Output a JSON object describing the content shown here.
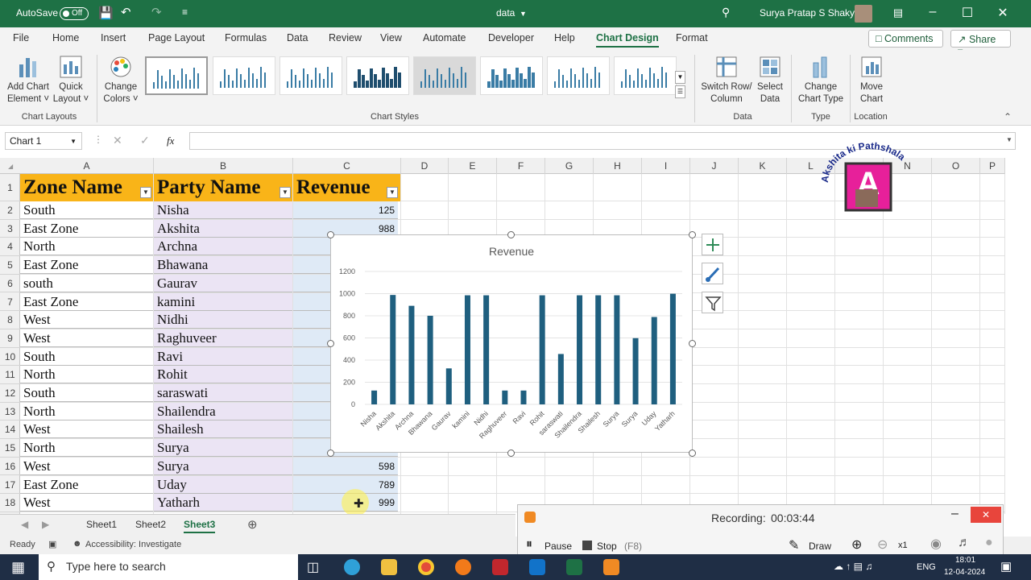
{
  "titlebar": {
    "autosave": "AutoSave",
    "toggle": "Off",
    "filename": "data",
    "user": "Surya Pratap S Shakya"
  },
  "tabs": [
    "File",
    "Home",
    "Insert",
    "Page Layout",
    "Formulas",
    "Data",
    "Review",
    "View",
    "Automate",
    "Developer",
    "Help",
    "Chart Design",
    "Format"
  ],
  "active_tab": "Chart Design",
  "top_buttons": {
    "comments": "Comments",
    "share": "Share"
  },
  "ribbon": {
    "add_chart_element": [
      "Add Chart",
      "Element"
    ],
    "quick_layout": [
      "Quick",
      "Layout"
    ],
    "change_colors": [
      "Change",
      "Colors"
    ],
    "switch_row_col": [
      "Switch Row/",
      "Column"
    ],
    "select_data": [
      "Select",
      "Data"
    ],
    "change_chart_type": [
      "Change",
      "Chart Type"
    ],
    "move_chart": [
      "Move",
      "Chart"
    ],
    "groups": {
      "chart_layouts": "Chart Layouts",
      "chart_styles": "Chart Styles",
      "data": "Data",
      "type": "Type",
      "location": "Location"
    }
  },
  "formula_bar": {
    "name_box": "Chart 1",
    "fx": "fx",
    "value": ""
  },
  "columns": [
    "A",
    "B",
    "C",
    "D",
    "E",
    "F",
    "G",
    "H",
    "I",
    "J",
    "K",
    "L",
    "M",
    "N",
    "O",
    "P"
  ],
  "rows": [
    "1",
    "2",
    "3",
    "4",
    "5",
    "6",
    "7",
    "8",
    "9",
    "10",
    "11",
    "12",
    "13",
    "14",
    "15",
    "16",
    "17",
    "18"
  ],
  "headers": {
    "zone": "Zone Name",
    "party": "Party Name",
    "revenue": "Revenue"
  },
  "table": [
    {
      "zone": "South",
      "party": "Nisha",
      "revenue": "125"
    },
    {
      "zone": "East Zone",
      "party": "Akshita",
      "revenue": "988"
    },
    {
      "zone": "North",
      "party": "Archna",
      "revenue": ""
    },
    {
      "zone": "East Zone",
      "party": "Bhawana",
      "revenue": ""
    },
    {
      "zone": "south",
      "party": "Gaurav",
      "revenue": ""
    },
    {
      "zone": "East Zone",
      "party": "kamini",
      "revenue": ""
    },
    {
      "zone": "West",
      "party": "Nidhi",
      "revenue": ""
    },
    {
      "zone": "West",
      "party": "Raghuveer",
      "revenue": ""
    },
    {
      "zone": "South",
      "party": "Ravi",
      "revenue": ""
    },
    {
      "zone": "North",
      "party": "Rohit",
      "revenue": ""
    },
    {
      "zone": "South",
      "party": "saraswati",
      "revenue": ""
    },
    {
      "zone": "North",
      "party": "Shailendra",
      "revenue": ""
    },
    {
      "zone": "West",
      "party": "Shailesh",
      "revenue": ""
    },
    {
      "zone": "North",
      "party": "Surya",
      "revenue": ""
    },
    {
      "zone": "West",
      "party": "Surya",
      "revenue": "598"
    },
    {
      "zone": "East Zone",
      "party": "Uday",
      "revenue": "789"
    },
    {
      "zone": "West",
      "party": "Yatharh",
      "revenue": "999"
    }
  ],
  "chart_data": {
    "type": "bar",
    "title": "Revenue",
    "categories": [
      "Nisha",
      "Akshita",
      "Archna",
      "Bhawana",
      "Gaurav",
      "kamini",
      "Nidhi",
      "Raghuveer",
      "Ravi",
      "Rohit",
      "saraswati",
      "Shailendra",
      "Shailesh",
      "Surya",
      "Surya",
      "Uday",
      "Yatharh"
    ],
    "values": [
      125,
      988,
      890,
      800,
      325,
      985,
      985,
      125,
      125,
      985,
      455,
      985,
      985,
      985,
      598,
      789,
      999
    ],
    "ylim": [
      0,
      1200
    ],
    "yticks": [
      "0",
      "200",
      "400",
      "600",
      "800",
      "1000",
      "1200"
    ],
    "grid": true,
    "color": "#1f5f7f"
  },
  "sheets": [
    "Sheet1",
    "Sheet2",
    "Sheet3"
  ],
  "active_sheet": "Sheet3",
  "status": {
    "ready": "Ready",
    "accessibility": "Accessibility: Investigate"
  },
  "logo_text": "Akshita ki Pathshala",
  "recorder": {
    "label": "Recording:",
    "time": "00:03:44",
    "pause": "Pause",
    "stop": "Stop",
    "stop_key": "(F8)",
    "draw": "Draw",
    "zoom": "x1"
  },
  "taskbar": {
    "search_placeholder": "Type here to search",
    "lang": "ENG",
    "time": "18:01",
    "date": "12-04-2024"
  }
}
